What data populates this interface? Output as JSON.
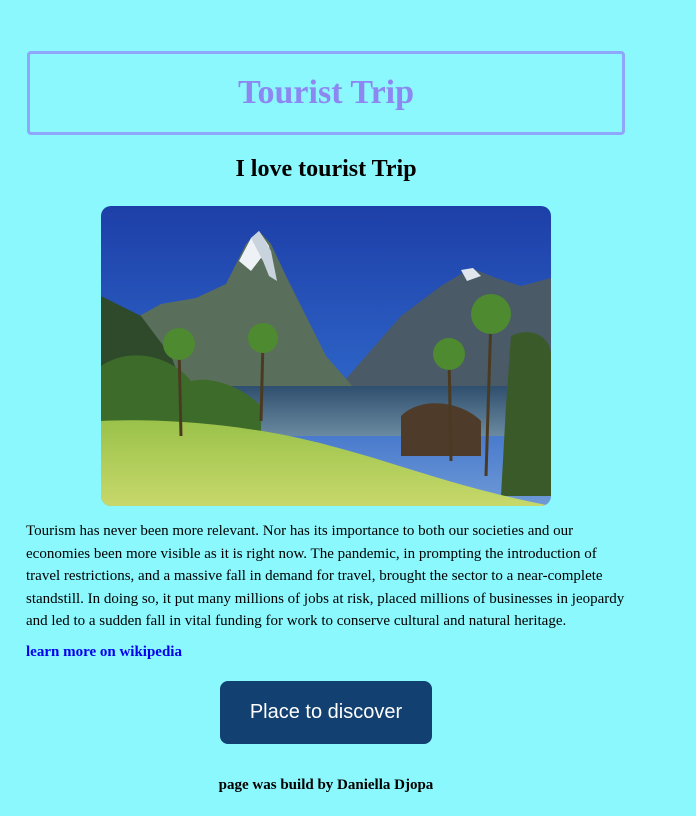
{
  "header": {
    "title": "Tourist Trip"
  },
  "main": {
    "subtitle": "I love tourist Trip",
    "hero_image": "mountain-lake-landscape",
    "paragraph": "Tourism has never been more relevant. Nor has its importance to both our societies and our economies been more visible as it is right now. The pandemic, in prompting the introduction of travel restrictions, and a massive fall in demand for travel, brought the sector to a near-complete standstill. In doing so, it put many millions of jobs at risk, placed millions of businesses in jeopardy and led to a sudden fall in vital funding for work to conserve cultural and natural heritage.",
    "link_label": "learn more on wikipedia",
    "button_label": "Place to discover"
  },
  "footer": {
    "credit": "page was build by Daniella Djopa"
  },
  "colors": {
    "background": "#8bf8fd",
    "title_border": "#8ea7fb",
    "title_text": "#8d87f2",
    "button_bg": "#124171",
    "link": "#0000ee"
  }
}
